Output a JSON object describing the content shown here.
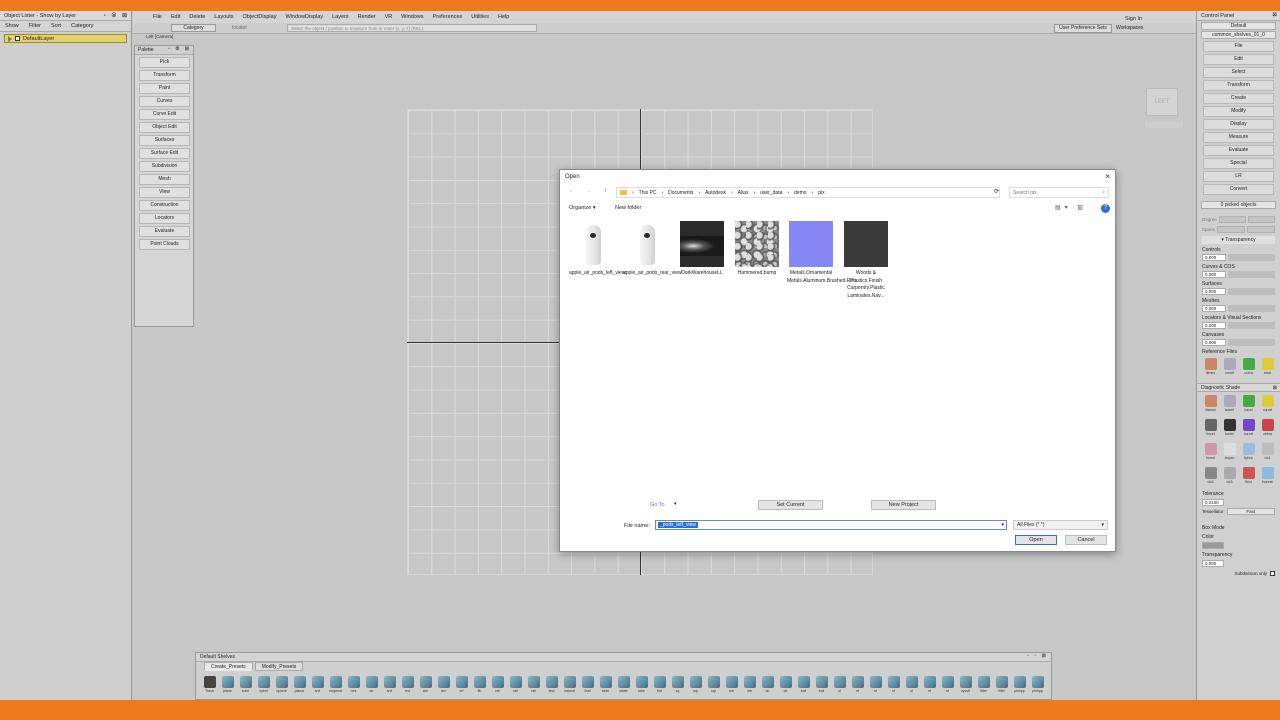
{
  "object_lister": {
    "title": "Object Lister - Show by Layer",
    "menu": [
      "Show",
      "Filter",
      "Sort",
      "Category"
    ],
    "layer": "DefaultLayer"
  },
  "menubar": {
    "items": [
      "File",
      "Edit",
      "Delete",
      "Layouts",
      "ObjectDisplay",
      "WindowDisplay",
      "Layers",
      "Render",
      "VR",
      "Windows",
      "Preferences",
      "Utilities",
      "Help"
    ],
    "sign_in": "Sign In"
  },
  "toolbar": {
    "category": "Category",
    "locator": "locator",
    "prompt": "Select the object / position to measure from or enter (x, y, z) (REL):",
    "user_pref": "User Preference Sets",
    "workspaces": "Workspaces",
    "show": "Show"
  },
  "viewport": {
    "view_label": "Left [Camera]",
    "cube_label": "LEFT"
  },
  "palette": {
    "title": "Palette",
    "items": [
      "Pick",
      "Transform",
      "Paint",
      "Curves",
      "Curve Edit",
      "Object Edit",
      "Surfaces",
      "Surface Edit",
      "Subdivision",
      "Mesh",
      "View",
      "Construction",
      "Locators",
      "Evaluate",
      "Point Clouds"
    ]
  },
  "dialog": {
    "title": "Open",
    "close": "×",
    "breadcrumb": [
      "This PC",
      "Documents",
      "Autodesk",
      "Alias",
      "user_data",
      "demo",
      "pix"
    ],
    "search_placeholder": "Search pix",
    "organize": "Organize ▾",
    "new_folder": "New folder",
    "files": [
      {
        "name": "apple_air_pods_left_view",
        "kind": "pod"
      },
      {
        "name": "apple_air_pods_rear_view",
        "kind": "pod"
      },
      {
        "name": "DarkWarehouseLL",
        "kind": "hdr"
      },
      {
        "name": "Hammered.bump",
        "kind": "hammer"
      },
      {
        "name": "Metals.Ornamental Metals.Aluminum.Brushed.Ren...",
        "kind": "bump"
      },
      {
        "name": "Woods & Plastics.Finish Carpentry.Plastic Laminates.Nav...",
        "kind": "dark"
      }
    ],
    "go_to": "Go To",
    "set_current": "Set Current",
    "new_project": "New Project",
    "file_name_label": "File name:",
    "file_name_value": "_pods_left_view",
    "file_type": "All Files (*.*)",
    "open": "Open",
    "cancel": "Cancel"
  },
  "shelves": {
    "title": "Default Shelves",
    "tabs": [
      "Create_Presets",
      "Modify_Presets"
    ],
    "icons": [
      "Trash",
      "plane",
      "cube",
      "cylnd",
      "sphere",
      "planar",
      "srvl",
      "mrgmsd",
      "rvrs",
      "ac",
      "srvl",
      "rnd",
      "skn",
      "drv",
      "srf",
      "ffb",
      "rail",
      "rail",
      "rail",
      "bnd",
      "natural",
      "2rail",
      "slide",
      "rotate",
      "tube",
      "flat",
      "sq",
      "sqr",
      "sqr",
      "mb",
      "mb",
      "cb",
      "cb",
      "bull",
      "bull",
      "sf",
      "sf",
      "sf",
      "sf",
      "sf",
      "sf",
      "sf",
      "cyvsft",
      "fillet",
      "fillet",
      "pinhpp",
      "pinhpp"
    ]
  },
  "control_panel": {
    "title": "Control Panel",
    "default": "Default",
    "shelf_name": "common_shelves_01_0",
    "menus": [
      "File",
      "Edit",
      "Select",
      "Transform",
      "Create",
      "Modify",
      "Display",
      "Measure",
      "Evaluate",
      "Special",
      "LR",
      "Convert"
    ],
    "picked": "0 picked objects",
    "degree": "Degree",
    "spans": "Spans",
    "transparency": "Transparency",
    "sections": [
      {
        "label": "Controls",
        "value": "0.000"
      },
      {
        "label": "Curves & COS",
        "value": "0.000"
      },
      {
        "label": "Surfaces",
        "value": "0.000"
      },
      {
        "label": "Meshes",
        "value": "0.000"
      },
      {
        "label": "Locators & Visual Sections",
        "value": "0.000"
      },
      {
        "label": "Canvases",
        "value": "0.000"
      }
    ],
    "reference_files": "Reference Files",
    "ref_icons": [
      "dlrnev",
      "ronsif",
      "curva",
      "swdt"
    ],
    "diag_title": "Diagnostic Shade",
    "diag_icons": [
      "nlshnm",
      "isoteri",
      "nacel",
      "curvel",
      "lincel",
      "horizn",
      "curvel",
      "zebra",
      "horntl",
      "cloysc",
      "ltphnc",
      "vis1",
      "vis2",
      "vis3",
      "flect",
      "lnonnel"
    ],
    "tolerance_label": "Tolerance",
    "tolerance_value": "0.0100",
    "tessellator_label": "Tessellator",
    "tessellator_value": "Fast",
    "box_mode": "Box Mode",
    "color": "Color",
    "transparency2": "Transparency",
    "transparency_value": "0.000",
    "subdivision_only": "Subdivision only"
  }
}
